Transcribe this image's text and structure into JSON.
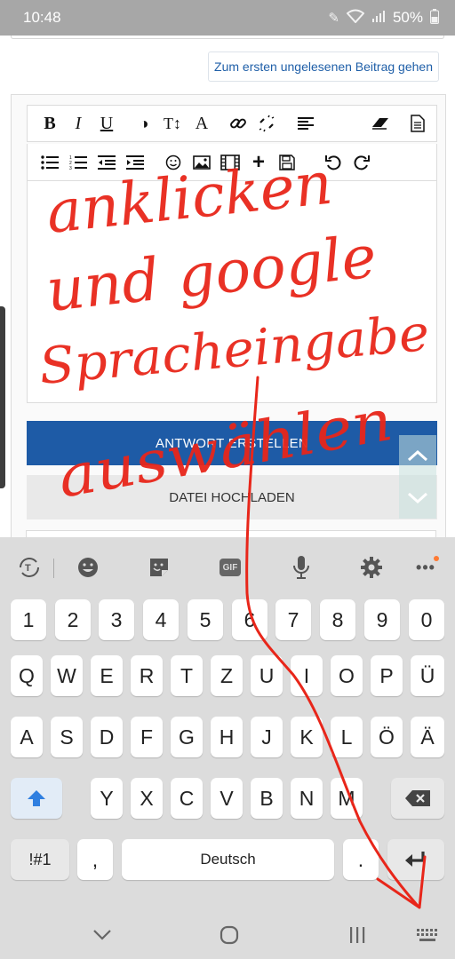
{
  "status": {
    "time": "10:48",
    "battery": "50%"
  },
  "page": {
    "unread_label": "Zum ersten ungelesenen Beitrag gehen",
    "toolbar_row1": [
      "B",
      "I",
      "U",
      "◑",
      "T↕",
      "A",
      "link",
      "unlink",
      "align",
      "eraser",
      "source"
    ],
    "toolbar_row2": [
      "bullets",
      "numbered",
      "outdent",
      "indent",
      "smiley",
      "image",
      "video",
      "plus",
      "save",
      "undo",
      "redo"
    ],
    "reply_label": "ANTWORT ERSTELLEN",
    "upload_label": "DATEI HOCHLADEN"
  },
  "keyboard": {
    "number_row": [
      "1",
      "2",
      "3",
      "4",
      "5",
      "6",
      "7",
      "8",
      "9",
      "0"
    ],
    "row1": [
      "Q",
      "W",
      "E",
      "R",
      "T",
      "Z",
      "U",
      "I",
      "O",
      "P",
      "Ü"
    ],
    "row2": [
      "A",
      "S",
      "D",
      "F",
      "G",
      "H",
      "J",
      "K",
      "L",
      "Ö",
      "Ä"
    ],
    "row3": [
      "Y",
      "X",
      "C",
      "V",
      "B",
      "N",
      "M"
    ],
    "symbols_label": "!#1",
    "comma_label": ",",
    "space_label": "Deutsch",
    "period_label": "."
  },
  "annotation": {
    "color": "#e8261a",
    "lines": [
      "anklicken",
      "und google",
      "Spracheingabe",
      "auswählen"
    ]
  }
}
